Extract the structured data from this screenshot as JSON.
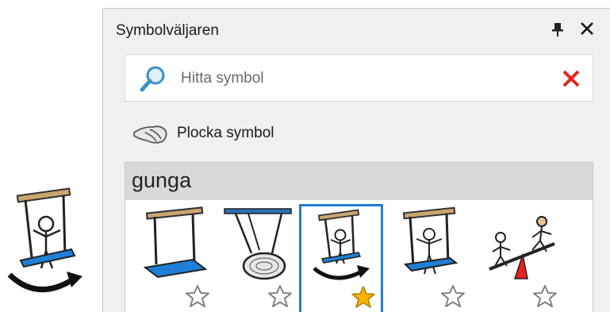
{
  "panel": {
    "title": "Symbolväljaren"
  },
  "search": {
    "placeholder": "Hitta symbol",
    "value": ""
  },
  "pick": {
    "label": "Plocka symbol"
  },
  "results": {
    "query": "gunga",
    "tiles": [
      {
        "icon": "swing-seat-icon",
        "favorite": false,
        "selected": false
      },
      {
        "icon": "nest-swing-icon",
        "favorite": false,
        "selected": false
      },
      {
        "icon": "person-swinging-arrow-icon",
        "favorite": true,
        "selected": true
      },
      {
        "icon": "person-on-swing-icon",
        "favorite": false,
        "selected": false
      },
      {
        "icon": "seesaw-icon",
        "favorite": false,
        "selected": false
      }
    ]
  },
  "colors": {
    "accent": "#1e7fd8",
    "clear": "#e8221b",
    "star_fill": "#f5b400",
    "seat": "#1f7fd6"
  }
}
